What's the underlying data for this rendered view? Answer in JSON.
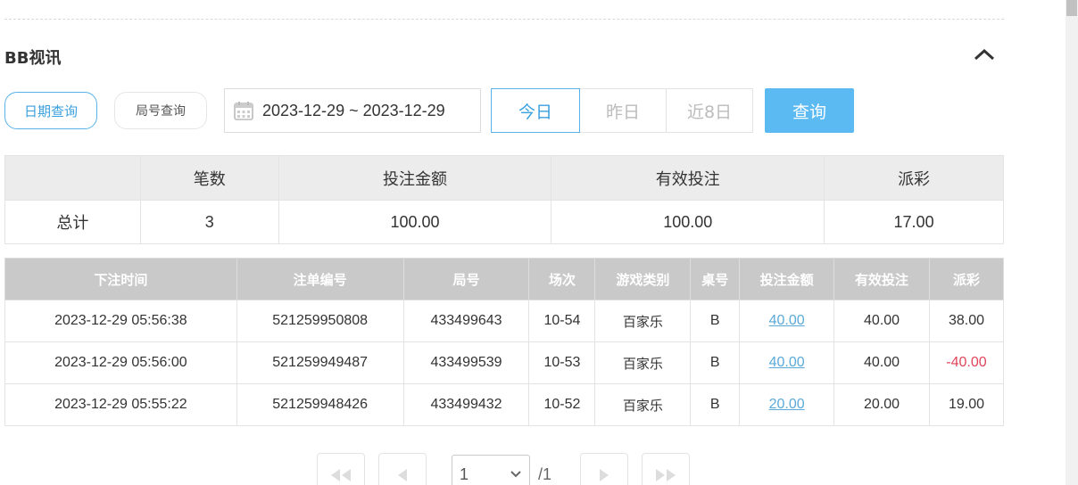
{
  "section": {
    "title": "BB视讯"
  },
  "query_modes": {
    "date": "日期查询",
    "round": "局号查询"
  },
  "date_range": {
    "value": "2023-12-29 ~ 2023-12-29"
  },
  "quick_ranges": [
    "今日",
    "昨日",
    "近8日"
  ],
  "query_button": "查询",
  "summary": {
    "headers": [
      "",
      "笔数",
      "投注金额",
      "有效投注",
      "派彩"
    ],
    "row": [
      "总计",
      "3",
      "100.00",
      "100.00",
      "17.00"
    ]
  },
  "detail": {
    "headers": [
      "下注时间",
      "注单编号",
      "局号",
      "场次",
      "游戏类别",
      "桌号",
      "投注金额",
      "有效投注",
      "派彩"
    ],
    "rows": [
      [
        "2023-12-29 05:56:38",
        "521259950808",
        "433499643",
        "10-54",
        "百家乐",
        "B",
        "40.00",
        "40.00",
        "38.00"
      ],
      [
        "2023-12-29 05:56:00",
        "521259949487",
        "433499539",
        "10-53",
        "百家乐",
        "B",
        "40.00",
        "40.00",
        "-40.00"
      ],
      [
        "2023-12-29 05:55:22",
        "521259948426",
        "433499432",
        "10-52",
        "百家乐",
        "B",
        "20.00",
        "20.00",
        "19.00"
      ]
    ]
  },
  "pagination": {
    "current": "1",
    "total": "/1"
  },
  "icons": {
    "collapse": "chevron-up-icon",
    "calendar": "calendar-icon"
  },
  "colors": {
    "accent": "#58b4e8",
    "button": "#5bbaf2",
    "negative": "#e0445a",
    "header_bg": "#c9c9c9"
  }
}
